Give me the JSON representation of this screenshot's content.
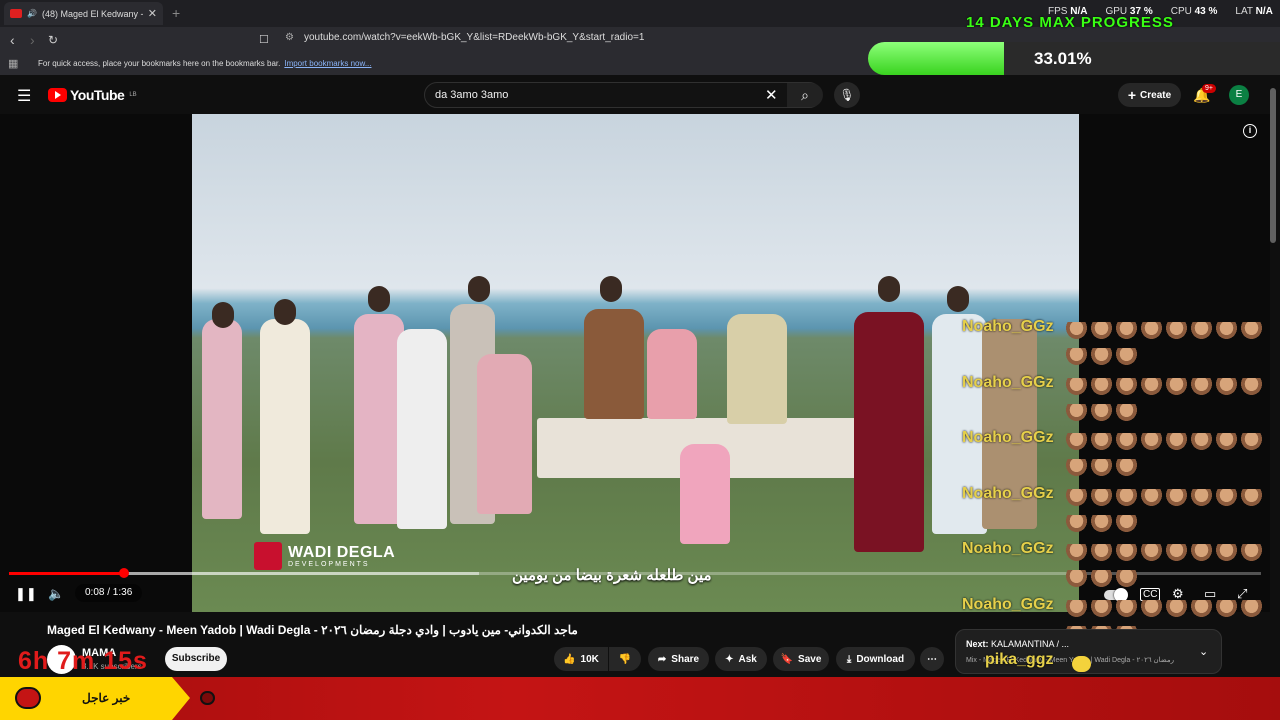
{
  "browser": {
    "tab_title": "(48) Maged El Kedwany - Me",
    "tab_close": "✕",
    "new_tab": "+",
    "url": "youtube.com/watch?v=eekWb-bGK_Y&list=RDeekWb-bGK_Y&start_radio=1",
    "bookmarks_text": "For quick access, place your bookmarks here on the bookmarks bar.",
    "bookmarks_link": "Import bookmarks now...",
    "stats": {
      "fps_label": "FPS",
      "fps_value": "N/A",
      "gpu_label": "GPU",
      "gpu_value": "37 %",
      "cpu_label": "CPU",
      "cpu_value": "43 %",
      "lat_label": "LAT",
      "lat_value": "N/A"
    }
  },
  "overlay": {
    "title": "14 DAYS MAX PROGRESS",
    "percent_text": "33.01%",
    "progress_fraction": 0.3301
  },
  "youtube": {
    "logo_text": "YouTube",
    "logo_country": "LB",
    "search_query": "da 3amo 3amo",
    "create_label": "Create",
    "notifications_badge": "9+",
    "avatar_letter": "E"
  },
  "player": {
    "brand_name": "WADI DEGLA",
    "brand_sub": "DEVELOPMENTS",
    "subtitle": "مين طلعله شعرة بيضا من يومين",
    "time_display": "0:08 / 1:36",
    "played_fraction": 0.092,
    "buffered_fraction": 0.375
  },
  "chat": {
    "username": "Noaho_GGz",
    "rows": 6,
    "second_user": "pika_ggz"
  },
  "video": {
    "title": "Maged El Kedwany - Meen Yadob | Wadi Degla - ماجد الكدواني- مين يادوب | وادي دجلة رمضان ٢٠٢٦",
    "channel": "MAMA",
    "subs": "3.1K subscribers",
    "subscribe_label": "Subscribe",
    "likes": "10K",
    "share_label": "Share",
    "ask_label": "Ask",
    "save_label": "Save",
    "download_label": "Download",
    "timer": "6h 7m 15s"
  },
  "next": {
    "prefix": "Next:",
    "name": "KALAMANTINA / ...",
    "sub": "Mix - Maged El Kedwany - Meen Yadob | Wadi Degla - رمضان ٢٠٢٦"
  },
  "news": {
    "label": "خبر عاجل"
  },
  "colors": {
    "yt_red": "#ff0000",
    "overlay_green": "#39ff14",
    "chat_gold": "#e6d04a",
    "news_red": "#c41414",
    "news_yellow": "#ffd500"
  }
}
